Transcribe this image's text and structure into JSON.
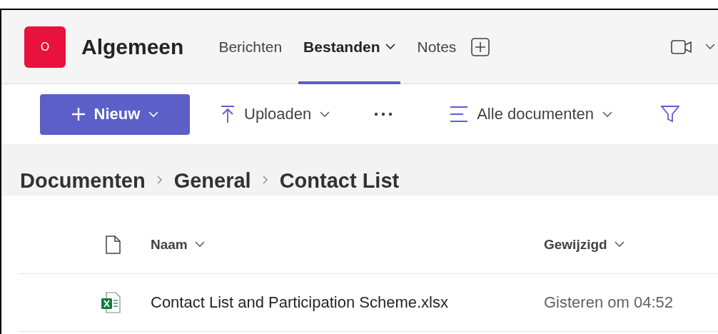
{
  "channel": {
    "avatar": "O",
    "name": "Algemeen"
  },
  "tabs": [
    {
      "label": "Berichten",
      "selected": false,
      "dropdown": false
    },
    {
      "label": "Bestanden",
      "selected": true,
      "dropdown": true
    },
    {
      "label": "Notes",
      "selected": false,
      "dropdown": false
    }
  ],
  "toolbar": {
    "new_label": "Nieuw",
    "upload_label": "Uploaden",
    "view_label": "Alle documenten"
  },
  "breadcrumb": [
    "Documenten",
    "General",
    "Contact List"
  ],
  "table": {
    "columns": [
      "Naam",
      "Gewijzigd"
    ],
    "rows": [
      {
        "kind": "excel",
        "name": "Contact List and Participation Scheme.xlsx",
        "modified": "Gisteren om 04:52"
      }
    ]
  }
}
